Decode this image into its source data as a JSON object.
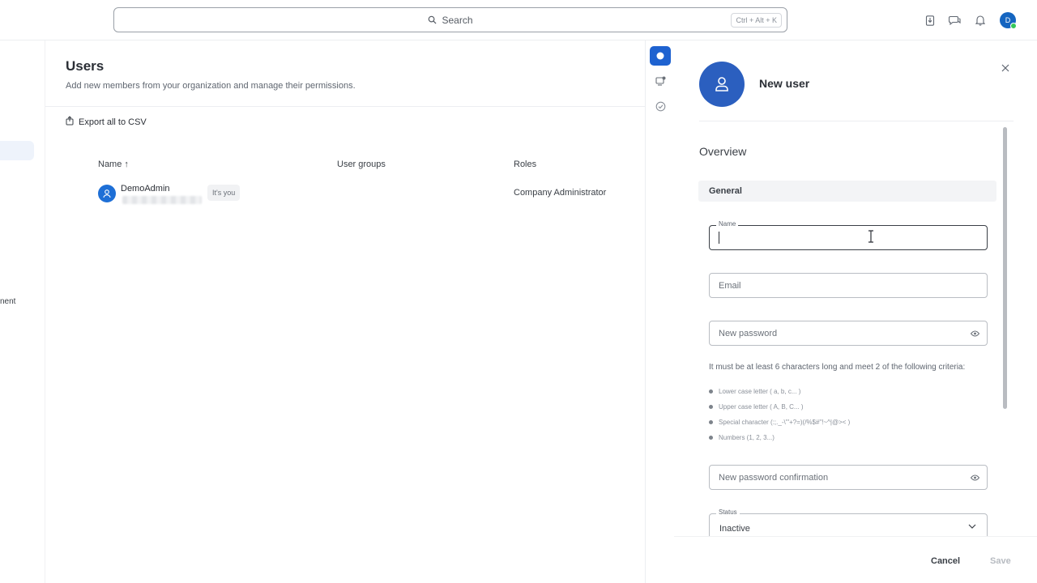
{
  "header": {
    "search_placeholder": "Search",
    "search_shortcut": "Ctrl + Alt + K",
    "icons": [
      "download-icon",
      "chat-icon",
      "bell-icon"
    ],
    "avatar_initial": "D"
  },
  "left_sidebar": {
    "cut_text": "nent"
  },
  "users_page": {
    "title": "Users",
    "subtitle": "Add new members from your organization and manage their permissions.",
    "export_label": "Export all to CSV",
    "columns": {
      "name": "Name ↑",
      "user_groups": "User groups",
      "roles": "Roles"
    },
    "rows": [
      {
        "name": "DemoAdmin",
        "badge": "It's you",
        "role": "Company Administrator"
      }
    ]
  },
  "panel": {
    "title": "New user",
    "section": "Overview",
    "subsection": "General",
    "fields": {
      "name_label": "Name",
      "email_placeholder": "Email",
      "password_placeholder": "New password",
      "password_confirm_placeholder": "New password confirmation",
      "status_label": "Status",
      "status_value": "Inactive"
    },
    "password_hint": "It must be at least 6 characters long and meet 2 of the following criteria:",
    "criteria": [
      "Lower case letter ( a, b, c... )",
      "Upper case letter ( A, B, C... )",
      "Special character (:;._-\\'\"+?=)(/%$#\"!~^|@>< )",
      "Numbers (1, 2, 3...)"
    ],
    "cancel_label": "Cancel",
    "save_label": "Save"
  },
  "colors": {
    "accent": "#1e62d0",
    "avatar": "#2b5fbf"
  }
}
